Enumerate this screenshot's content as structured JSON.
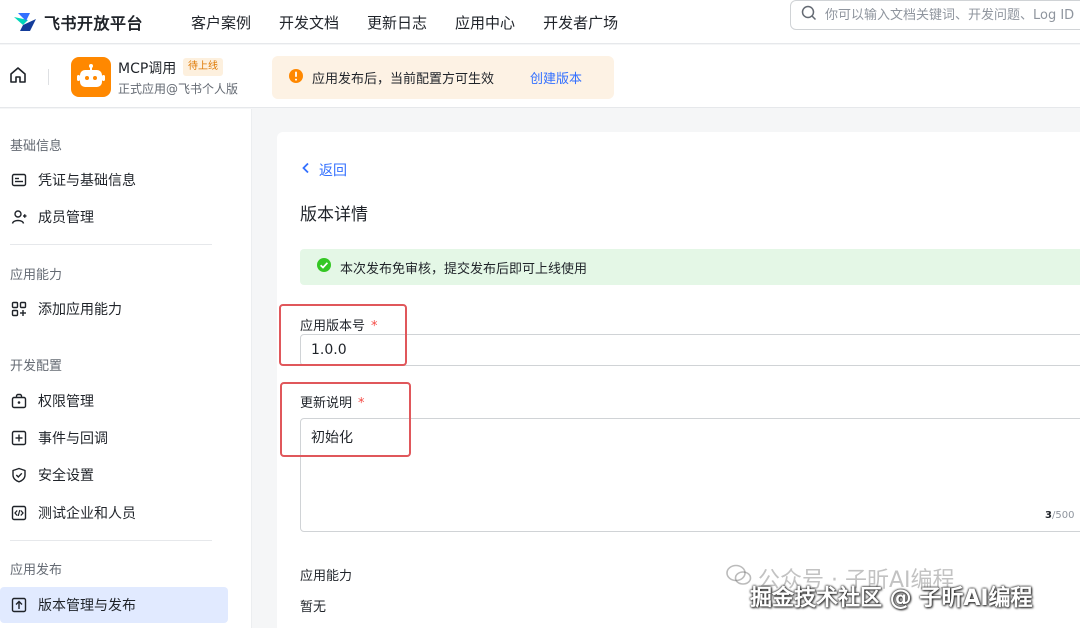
{
  "brand": {
    "name": "飞书开放平台"
  },
  "nav": {
    "links": [
      "客户案例",
      "开发文档",
      "更新日志",
      "应用中心",
      "开发者广场"
    ]
  },
  "search": {
    "placeholder": "你可以输入文档关键词、开发问题、Log ID"
  },
  "appbar": {
    "app_name": "MCP调用",
    "status_badge": "待上线",
    "app_sub": "正式应用@飞书个人版",
    "notice_text": "应用发布后，当前配置方可生效",
    "notice_link": "创建版本"
  },
  "sidebar": {
    "groups": [
      {
        "title": "基础信息",
        "items": [
          {
            "label": "凭证与基础信息",
            "icon": "id-card-icon"
          },
          {
            "label": "成员管理",
            "icon": "member-icon"
          }
        ]
      },
      {
        "title": "应用能力",
        "items": [
          {
            "label": "添加应用能力",
            "icon": "add-capability-icon"
          }
        ]
      },
      {
        "title": "开发配置",
        "items": [
          {
            "label": "权限管理",
            "icon": "permission-icon"
          },
          {
            "label": "事件与回调",
            "icon": "event-icon"
          },
          {
            "label": "安全设置",
            "icon": "shield-icon"
          },
          {
            "label": "测试企业和人员",
            "icon": "code-icon"
          }
        ]
      },
      {
        "title": "应用发布",
        "items": [
          {
            "label": "版本管理与发布",
            "icon": "upload-icon",
            "active": true
          }
        ]
      }
    ]
  },
  "main": {
    "back_label": "返回",
    "title": "版本详情",
    "success_text": "本次发布免审核，提交发布后即可上线使用",
    "version_label": "应用版本号",
    "version_value": "1.0.0",
    "notes_label": "更新说明",
    "notes_value": "初始化",
    "notes_count": "3",
    "notes_max": "/500",
    "required_mark": "*",
    "capability_label": "应用能力",
    "capability_value": "暂无"
  },
  "watermark": {
    "line1": "公众号 · 子昕AI编程",
    "line2": "掘金技术社区 @ 子昕AI编程"
  },
  "colors": {
    "accent": "#3370ff",
    "highlight": "#e0575b",
    "success_bg": "#e4f7e6",
    "notice_bg": "#fdf2e4"
  }
}
